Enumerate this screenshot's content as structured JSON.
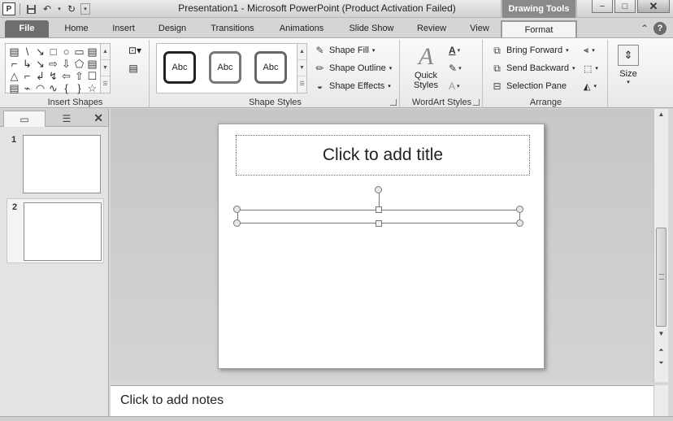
{
  "titlebar": {
    "title": "Presentation1  -  Microsoft PowerPoint (Product Activation Failed)",
    "context_tab": "Drawing Tools",
    "controls": {
      "minimize": "−",
      "maximize": "□",
      "close": "✕"
    }
  },
  "tabs": [
    {
      "label": "File"
    },
    {
      "label": "Home"
    },
    {
      "label": "Insert"
    },
    {
      "label": "Design"
    },
    {
      "label": "Transitions"
    },
    {
      "label": "Animations"
    },
    {
      "label": "Slide Show"
    },
    {
      "label": "Review"
    },
    {
      "label": "View"
    },
    {
      "label": "Format"
    }
  ],
  "ribbon": {
    "insert_shapes": {
      "label": "Insert Shapes",
      "glyphs": [
        "▤",
        "\\",
        "↘",
        "□",
        "○",
        "▭",
        "▤",
        "⌐",
        "↳",
        "↘",
        "⇨",
        "⇩",
        "⬠",
        "▤",
        "△",
        "⌐",
        "↲",
        "↯",
        "⇦",
        "⇧",
        "☐",
        "▤",
        "⌁",
        "◠",
        "∿",
        "{",
        "}",
        "☆"
      ]
    },
    "shape_styles": {
      "label": "Shape Styles",
      "thumb_text": "Abc",
      "fill": "Shape Fill",
      "outline": "Shape Outline",
      "effects": "Shape Effects"
    },
    "wordart": {
      "label": "WordArt Styles",
      "quick_styles": "Quick Styles",
      "glyph": "A"
    },
    "arrange": {
      "label": "Arrange",
      "bring_forward": "Bring Forward",
      "send_backward": "Send Backward",
      "selection_pane": "Selection Pane"
    },
    "size": {
      "label": "Size"
    }
  },
  "slides_pane": {
    "slides": [
      {
        "number": "1"
      },
      {
        "number": "2"
      }
    ],
    "close": "✕"
  },
  "slide": {
    "title_placeholder": "Click to add title"
  },
  "notes": {
    "placeholder": "Click to add notes"
  }
}
